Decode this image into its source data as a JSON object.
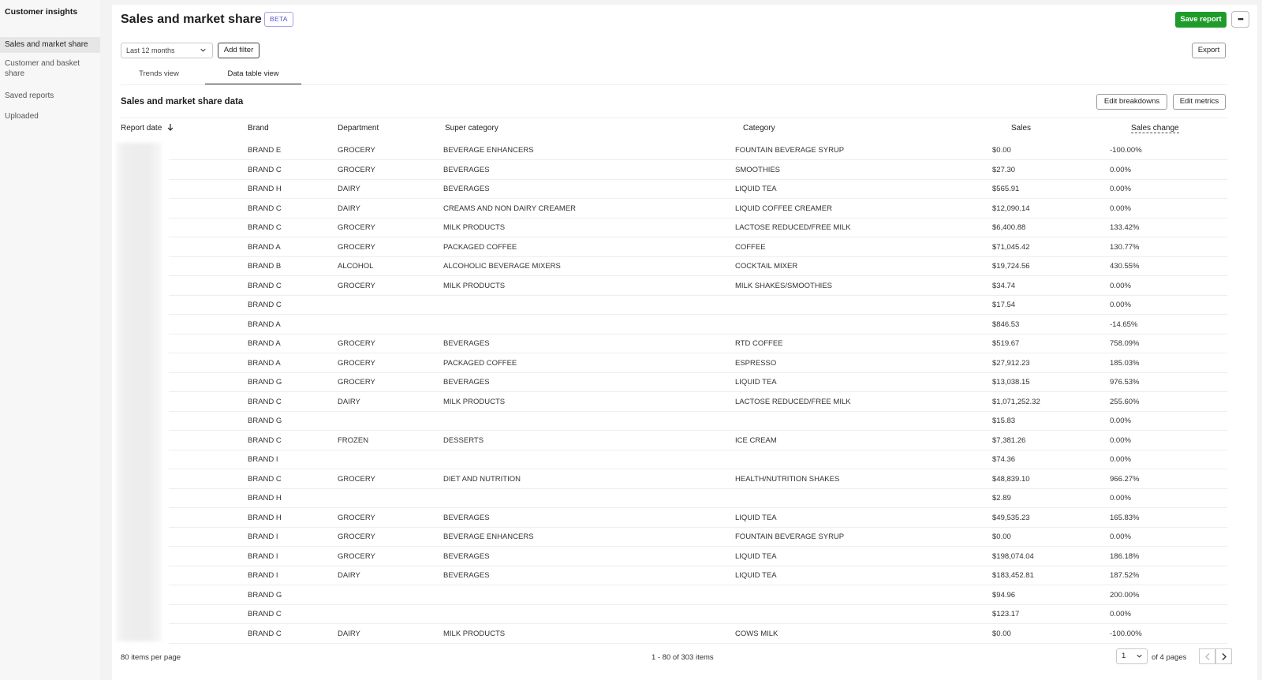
{
  "sidebar": {
    "title": "Customer insights",
    "items": [
      {
        "label": "Sales and market share",
        "active": true
      },
      {
        "label": "Customer and basket share",
        "active": false
      },
      {
        "label": "Saved reports",
        "active": false
      },
      {
        "label": "Uploaded",
        "active": false
      }
    ]
  },
  "header": {
    "title": "Sales and market share",
    "badge": "BETA",
    "save_label": "Save report",
    "more_label": "•••"
  },
  "filters": {
    "date_range": "Last 12 months",
    "add_filter_label": "Add filter",
    "export_label": "Export"
  },
  "tabs": [
    {
      "label": "Trends view",
      "active": false
    },
    {
      "label": "Data table view",
      "active": true
    }
  ],
  "section": {
    "title": "Sales and market share data",
    "edit_breakdowns_label": "Edit breakdowns",
    "edit_metrics_label": "Edit metrics"
  },
  "table": {
    "columns": [
      "Report date",
      "Brand",
      "Department",
      "Super category",
      "Category",
      "Sales",
      "Sales change"
    ],
    "rows": [
      {
        "brand": "BRAND E",
        "department": "GROCERY",
        "super_category": "BEVERAGE ENHANCERS",
        "category": "FOUNTAIN BEVERAGE SYRUP",
        "sales": "$0.00",
        "sales_change": "-100.00%"
      },
      {
        "brand": "BRAND C",
        "department": "GROCERY",
        "super_category": "BEVERAGES",
        "category": "SMOOTHIES",
        "sales": "$27.30",
        "sales_change": "0.00%"
      },
      {
        "brand": "BRAND H",
        "department": "DAIRY",
        "super_category": "BEVERAGES",
        "category": "LIQUID TEA",
        "sales": "$565.91",
        "sales_change": "0.00%"
      },
      {
        "brand": "BRAND C",
        "department": "DAIRY",
        "super_category": "CREAMS AND NON DAIRY CREAMER",
        "category": "LIQUID COFFEE CREAMER",
        "sales": "$12,090.14",
        "sales_change": "0.00%"
      },
      {
        "brand": "BRAND C",
        "department": "GROCERY",
        "super_category": "MILK PRODUCTS",
        "category": "LACTOSE REDUCED/FREE MILK",
        "sales": "$6,400.88",
        "sales_change": "133.42%"
      },
      {
        "brand": "BRAND A",
        "department": "GROCERY",
        "super_category": "PACKAGED COFFEE",
        "category": "COFFEE",
        "sales": "$71,045.42",
        "sales_change": "130.77%"
      },
      {
        "brand": "BRAND B",
        "department": "ALCOHOL",
        "super_category": "ALCOHOLIC BEVERAGE MIXERS",
        "category": "COCKTAIL MIXER",
        "sales": "$19,724.56",
        "sales_change": "430.55%"
      },
      {
        "brand": "BRAND C",
        "department": "GROCERY",
        "super_category": "MILK PRODUCTS",
        "category": "MILK SHAKES/SMOOTHIES",
        "sales": "$34.74",
        "sales_change": "0.00%"
      },
      {
        "brand": "BRAND C",
        "department": "",
        "super_category": "",
        "category": "",
        "sales": "$17.54",
        "sales_change": "0.00%"
      },
      {
        "brand": "BRAND A",
        "department": "",
        "super_category": "",
        "category": "",
        "sales": "$846.53",
        "sales_change": "-14.65%"
      },
      {
        "brand": "BRAND A",
        "department": "GROCERY",
        "super_category": "BEVERAGES",
        "category": "RTD COFFEE",
        "sales": "$519.67",
        "sales_change": "758.09%"
      },
      {
        "brand": "BRAND A",
        "department": "GROCERY",
        "super_category": "PACKAGED COFFEE",
        "category": "ESPRESSO",
        "sales": "$27,912.23",
        "sales_change": "185.03%"
      },
      {
        "brand": "BRAND G",
        "department": "GROCERY",
        "super_category": "BEVERAGES",
        "category": "LIQUID TEA",
        "sales": "$13,038.15",
        "sales_change": "976.53%"
      },
      {
        "brand": "BRAND C",
        "department": "DAIRY",
        "super_category": "MILK PRODUCTS",
        "category": "LACTOSE REDUCED/FREE MILK",
        "sales": "$1,071,252.32",
        "sales_change": "255.60%"
      },
      {
        "brand": "BRAND G",
        "department": "",
        "super_category": "",
        "category": "",
        "sales": "$15.83",
        "sales_change": "0.00%"
      },
      {
        "brand": "BRAND C",
        "department": "FROZEN",
        "super_category": "DESSERTS",
        "category": "ICE CREAM",
        "sales": "$7,381.26",
        "sales_change": "0.00%"
      },
      {
        "brand": "BRAND I",
        "department": "",
        "super_category": "",
        "category": "",
        "sales": "$74.36",
        "sales_change": "0.00%"
      },
      {
        "brand": "BRAND C",
        "department": "GROCERY",
        "super_category": "DIET AND NUTRITION",
        "category": "HEALTH/NUTRITION SHAKES",
        "sales": "$48,839.10",
        "sales_change": "966.27%"
      },
      {
        "brand": "BRAND H",
        "department": "",
        "super_category": "",
        "category": "",
        "sales": "$2.89",
        "sales_change": "0.00%"
      },
      {
        "brand": "BRAND H",
        "department": "GROCERY",
        "super_category": "BEVERAGES",
        "category": "LIQUID TEA",
        "sales": "$49,535.23",
        "sales_change": "165.83%"
      },
      {
        "brand": "BRAND I",
        "department": "GROCERY",
        "super_category": "BEVERAGE ENHANCERS",
        "category": "FOUNTAIN BEVERAGE SYRUP",
        "sales": "$0.00",
        "sales_change": "0.00%"
      },
      {
        "brand": "BRAND I",
        "department": "GROCERY",
        "super_category": "BEVERAGES",
        "category": "LIQUID TEA",
        "sales": "$198,074.04",
        "sales_change": "186.18%"
      },
      {
        "brand": "BRAND I",
        "department": "DAIRY",
        "super_category": "BEVERAGES",
        "category": "LIQUID TEA",
        "sales": "$183,452.81",
        "sales_change": "187.52%"
      },
      {
        "brand": "BRAND G",
        "department": "",
        "super_category": "",
        "category": "",
        "sales": "$94.96",
        "sales_change": "200.00%"
      },
      {
        "brand": "BRAND C",
        "department": "",
        "super_category": "",
        "category": "",
        "sales": "$123.17",
        "sales_change": "0.00%"
      },
      {
        "brand": "BRAND C",
        "department": "DAIRY",
        "super_category": "MILK PRODUCTS",
        "category": "COWS MILK",
        "sales": "$0.00",
        "sales_change": "-100.00%"
      }
    ]
  },
  "footer": {
    "per_page": "80 items per page",
    "range": "1 - 80 of 303 items",
    "page": "1",
    "of_pages": "of 4 pages"
  },
  "colors": {
    "accent_green": "#1f9b2c",
    "beta_purple": "#5b4fd6"
  },
  "icons": [
    "chevron-down-icon",
    "sort-arrow-down-icon",
    "more-icon",
    "chevron-left-icon",
    "chevron-right-icon"
  ]
}
